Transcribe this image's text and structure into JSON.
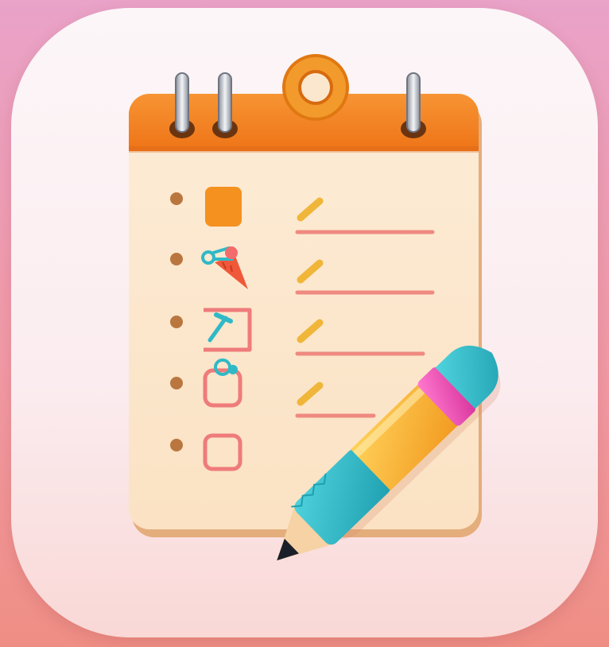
{
  "app_icon": {
    "kind": "checklist-with-pencil",
    "colors": {
      "background_top": "#e9a2c8",
      "background_bottom": "#ef8e84",
      "tile": "#fbf0f2",
      "paper": "#fbe7cd",
      "paper_edge": "#e4ad7c",
      "header": "#f47f1e",
      "header_dark": "#d76210",
      "ring": "#f29a2b",
      "checkbox_filled": "#f5911f",
      "checkbox_outline": "#ef7b7b",
      "line": "#ef8a80",
      "tick": "#f0b63a",
      "pencil_body": "#f5a623",
      "pencil_teal": "#2fb9c7",
      "pencil_band": "#e94fb0"
    },
    "checklist_rows": [
      {
        "checkbox": "filled"
      },
      {
        "checkbox": "carrot-icon"
      },
      {
        "checkbox": "hammer-checked"
      },
      {
        "checkbox": "clip-icon"
      },
      {
        "checkbox": "empty"
      }
    ]
  }
}
